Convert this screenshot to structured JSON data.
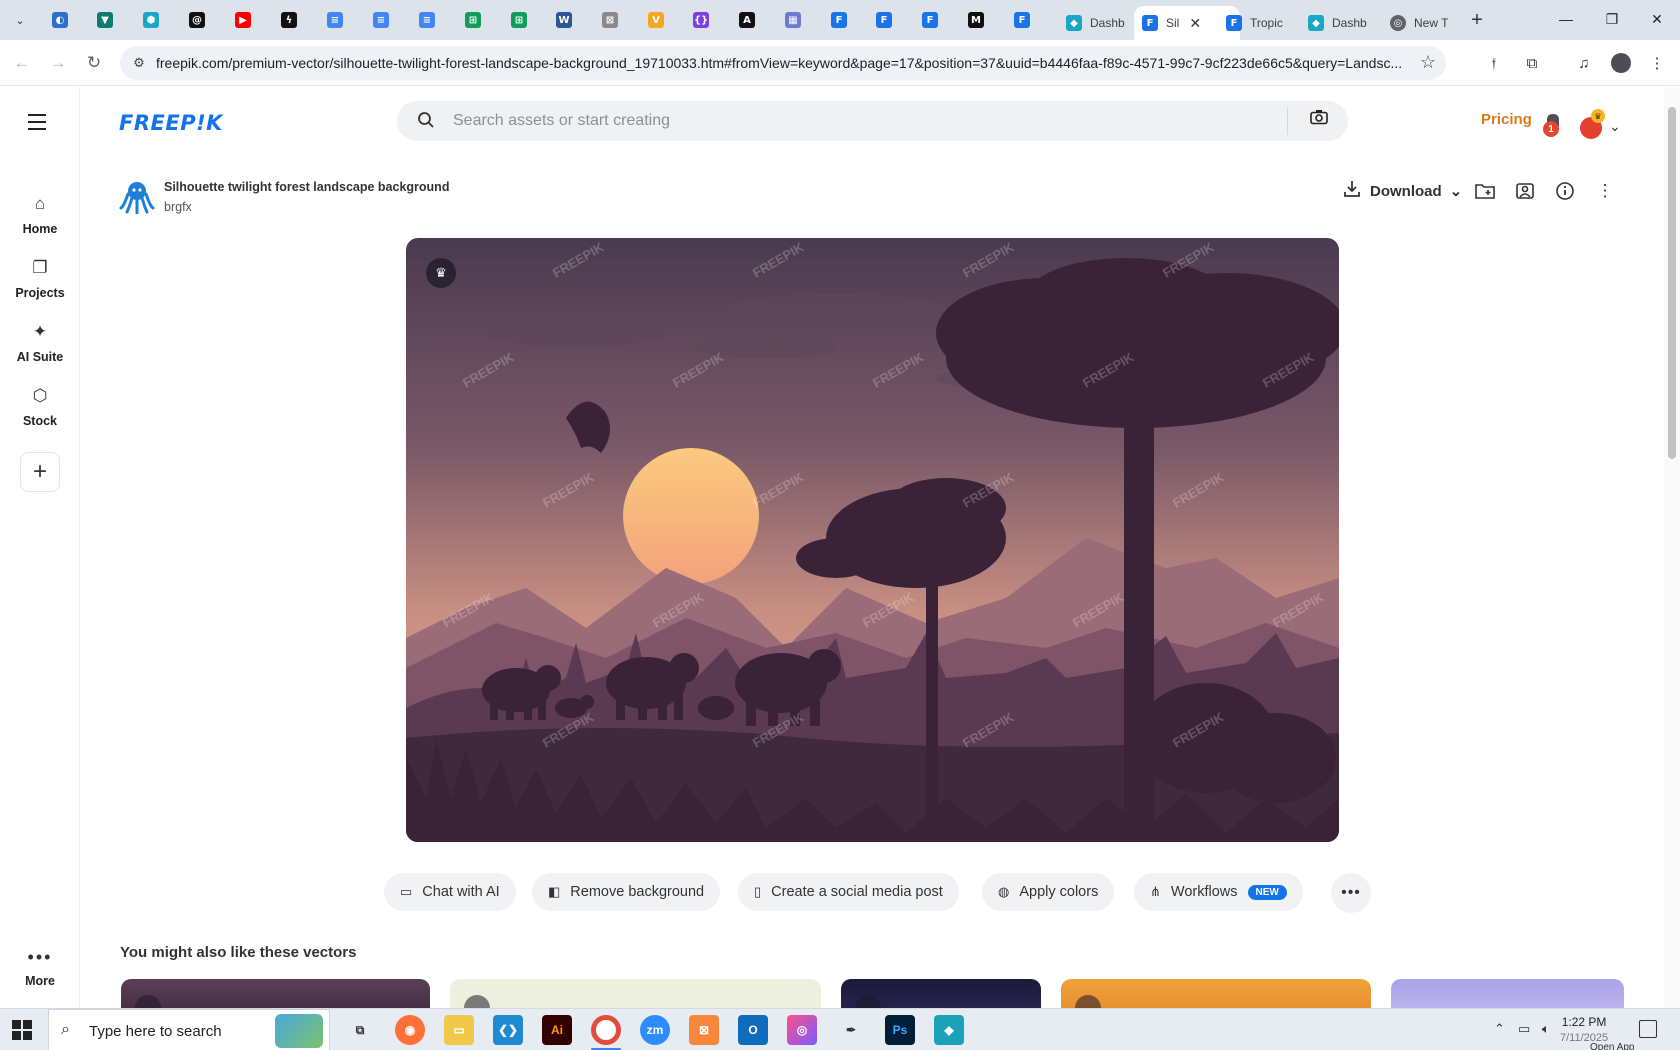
{
  "browser": {
    "pinned_tabs": [
      {
        "icon": "globe-blue-icon",
        "color": "#2b6fd1"
      },
      {
        "icon": "vpn-shield-icon",
        "color": "#0f7a6e"
      },
      {
        "icon": "hexagon-icon",
        "color": "#19a7c7"
      },
      {
        "icon": "threads-icon",
        "color": "#111111"
      },
      {
        "icon": "youtube-icon",
        "color": "#ff0000"
      },
      {
        "icon": "bolt-icon",
        "color": "#111111"
      },
      {
        "icon": "docs-icon",
        "color": "#4285f4"
      },
      {
        "icon": "docs-icon",
        "color": "#4285f4"
      },
      {
        "icon": "docs-icon",
        "color": "#4285f4"
      },
      {
        "icon": "sheets-icon",
        "color": "#0f9d58"
      },
      {
        "icon": "sheets-icon",
        "color": "#0f9d58"
      },
      {
        "icon": "word-icon",
        "color": "#2b5797"
      },
      {
        "icon": "image-icon",
        "color": "#8a8a8a"
      },
      {
        "icon": "chevron-v-icon",
        "color": "#f5a623"
      },
      {
        "icon": "braces-icon",
        "color": "#7b3fe4"
      },
      {
        "icon": "a-icon",
        "color": "#111111"
      },
      {
        "icon": "grid-icon",
        "color": "#6b7ccf"
      },
      {
        "icon": "forms-icon",
        "color": "#1a73e8"
      },
      {
        "icon": "forms-icon",
        "color": "#1a73e8"
      },
      {
        "icon": "forms-icon",
        "color": "#1a73e8"
      },
      {
        "icon": "medium-icon",
        "color": "#111111"
      },
      {
        "icon": "forms-icon",
        "color": "#1a73e8"
      }
    ],
    "tabs": [
      {
        "label": "Dashb",
        "icon": "diamond-icon",
        "color": "#19a7c7"
      },
      {
        "label": "Sil",
        "icon": "freepik-tab-icon",
        "color": "#1a73e8",
        "active": true
      },
      {
        "label": "Tropic",
        "icon": "freepik-tab-icon",
        "color": "#1a73e8"
      },
      {
        "label": "Dashb",
        "icon": "diamond-icon",
        "color": "#19a7c7"
      },
      {
        "label": "New T",
        "icon": "chrome-icon",
        "color": "#5f6368"
      }
    ],
    "url": "freepik.com/premium-vector/silhouette-twilight-forest-landscape-background_19710033.htm#fromView=keyword&page=17&position=37&uuid=b4446faa-f89c-4571-99c7-9cf223de66c5&query=Landsc..."
  },
  "sidebar": {
    "items": [
      {
        "label": "Home",
        "icon": "home-icon"
      },
      {
        "label": "Projects",
        "icon": "projects-icon"
      },
      {
        "label": "AI Suite",
        "icon": "sparkles-icon"
      },
      {
        "label": "Stock",
        "icon": "stock-icon"
      }
    ],
    "more_label": "More"
  },
  "header": {
    "logo": "FREEP!K",
    "search_placeholder": "Search assets or start creating",
    "pricing_label": "Pricing",
    "notification_count": "1"
  },
  "asset": {
    "title": "Silhouette twilight forest landscape background",
    "author": "brgfx",
    "download_label": "Download",
    "watermark": "FREEPIK"
  },
  "actions": [
    {
      "label": "Chat with AI",
      "icon": "chat-ai-icon"
    },
    {
      "label": "Remove background",
      "icon": "remove-bg-icon"
    },
    {
      "label": "Create a social media post",
      "icon": "phone-icon"
    },
    {
      "label": "Apply colors",
      "icon": "palette-icon"
    },
    {
      "label": "Workflows",
      "icon": "workflow-icon",
      "badge": "NEW"
    }
  ],
  "related": {
    "title": "You might also like these vectors"
  },
  "taskbar": {
    "search_text": "Type here to search",
    "time": "1:22 PM",
    "date": "7/11/2025",
    "open_app": "Open App"
  },
  "colors": {
    "brand": "#1273eb",
    "pricing": "#d97a1f"
  }
}
